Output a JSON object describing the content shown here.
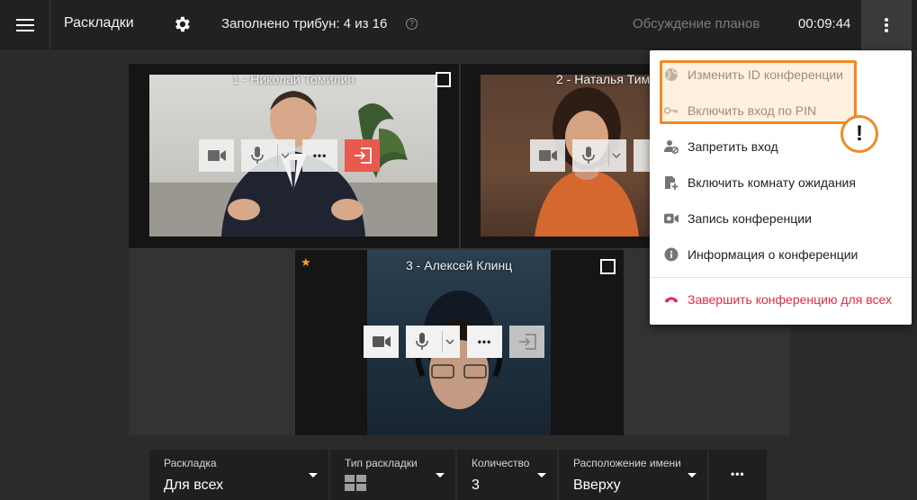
{
  "topbar": {
    "title": "Раскладки",
    "tribune_status": "Заполнено трибун: 4 из 16",
    "help_glyph": "?",
    "meeting_name": "Обсуждение планов",
    "timer": "00:09:44",
    "icons": {
      "menu": "menu-icon",
      "settings": "gear-icon",
      "help": "help-icon",
      "more": "more-vert-icon"
    }
  },
  "tiles": [
    {
      "name": "1 - Николай Томилин",
      "pinned": false
    },
    {
      "name": "2 - Наталья Тим",
      "pinned": false
    },
    {
      "name": "3 - Алексей Клинц",
      "pinned": true
    }
  ],
  "tile_controls": {
    "camera": "camera-icon",
    "mic": "mic-icon",
    "more_glyph": "•••",
    "exit": "exit-icon"
  },
  "menu": {
    "items": [
      {
        "label": "Изменить ID конференции",
        "icon": "globe-icon",
        "highlighted": true
      },
      {
        "label": "Включить вход по PIN",
        "icon": "key-icon",
        "highlighted": true
      },
      {
        "label": "Запретить вход",
        "icon": "block-user-icon"
      },
      {
        "label": "Включить комнату ожидания",
        "icon": "waiting-room-icon"
      },
      {
        "label": "Запись конференции",
        "icon": "record-icon"
      },
      {
        "label": "Информация о конференции",
        "icon": "info-icon"
      },
      {
        "label": "Завершить конференцию для всех",
        "icon": "hangup-icon",
        "danger": true
      }
    ],
    "alert_glyph": "!"
  },
  "bottom": {
    "layout": {
      "label": "Раскладка",
      "value": "Для всех"
    },
    "layout_type": {
      "label": "Тип раскладки",
      "value_icon": "grid-icon"
    },
    "count": {
      "label": "Количество",
      "value": "3"
    },
    "name_position": {
      "label": "Расположение имени",
      "value": "Вверху"
    },
    "more_glyph": "•••"
  },
  "colors": {
    "accent_orange": "#f08a24",
    "danger_red": "#e8284a",
    "exit_red": "#e9594d",
    "pin_star": "#ff9c28"
  }
}
